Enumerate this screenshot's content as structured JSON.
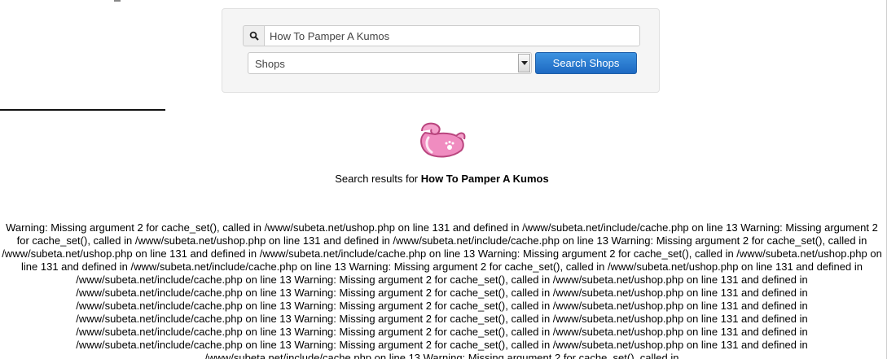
{
  "search": {
    "query_value": "How To Pamper A Kumos",
    "icon": "search-icon",
    "category_selected": "Shops",
    "button_label": "Search Shops"
  },
  "results": {
    "prefix": "Search results for ",
    "query": "How To Pamper A Kumos"
  },
  "mascot": {
    "icon": "pink-pet-mascot"
  },
  "warning_text": "Warning: Missing argument 2 for cache_set(), called in /www/subeta.net/ushop.php on line 131 and defined in /www/subeta.net/include/cache.php on line 13 Warning: Missing argument 2 for cache_set(), called in /www/subeta.net/ushop.php on line 131 and defined in /www/subeta.net/include/cache.php on line 13 Warning: Missing argument 2 for cache_set(), called in /www/subeta.net/ushop.php on line 131 and defined in /www/subeta.net/include/cache.php on line 13 Warning: Missing argument 2 for cache_set(), called in /www/subeta.net/ushop.php on line 131 and defined in /www/subeta.net/include/cache.php on line 13 Warning: Missing argument 2 for cache_set(), called in /www/subeta.net/ushop.php on line 131 and defined in /www/subeta.net/include/cache.php on line 13 Warning: Missing argument 2 for cache_set(), called in /www/subeta.net/ushop.php on line 131 and defined in /www/subeta.net/include/cache.php on line 13 Warning: Missing argument 2 for cache_set(), called in /www/subeta.net/ushop.php on line 131 and defined in /www/subeta.net/include/cache.php on line 13 Warning: Missing argument 2 for cache_set(), called in /www/subeta.net/ushop.php on line 131 and defined in /www/subeta.net/include/cache.php on line 13 Warning: Missing argument 2 for cache_set(), called in /www/subeta.net/ushop.php on line 131 and defined in /www/subeta.net/include/cache.php on line 13 Warning: Missing argument 2 for cache_set(), called in /www/subeta.net/ushop.php on line 131 and defined in /www/subeta.net/include/cache.php on line 13 Warning: Missing argument 2 for cache_set(), called in /www/subeta.net/ushop.php on line 131 and defined in /www/subeta.net/include/cache.php on line 13 Warning: Missing argument 2 for cache_set(), called in",
  "colors": {
    "button_top": "#3d93e0",
    "button_bottom": "#1d69c2",
    "panel_bg": "#f5f5f5",
    "mascot_pink": "#f08cc0"
  }
}
